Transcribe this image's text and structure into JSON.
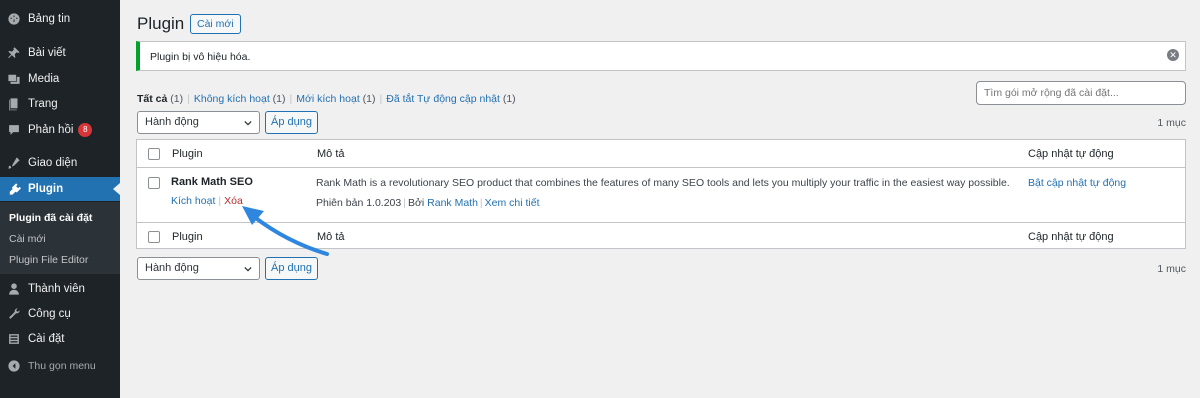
{
  "sidebar": {
    "items": [
      {
        "label": "Bảng tin",
        "icon": "dashboard-icon"
      },
      {
        "label": "Bài viết",
        "icon": "pin-icon"
      },
      {
        "label": "Media",
        "icon": "media-icon"
      },
      {
        "label": "Trang",
        "icon": "page-icon"
      },
      {
        "label": "Phản hồi",
        "icon": "comment-icon",
        "badge": "8"
      },
      {
        "label": "Giao diện",
        "icon": "appearance-icon"
      },
      {
        "label": "Plugin",
        "icon": "plugin-icon"
      },
      {
        "label": "Thành viên",
        "icon": "users-icon"
      },
      {
        "label": "Công cụ",
        "icon": "tools-icon"
      },
      {
        "label": "Cài đặt",
        "icon": "settings-icon"
      },
      {
        "label": "Thu gọn menu",
        "icon": "collapse-icon"
      }
    ],
    "submenu": [
      "Plugin đã cài đặt",
      "Cài mới",
      "Plugin File Editor"
    ]
  },
  "header": {
    "title": "Plugin",
    "add_new": "Cài mới"
  },
  "notice": {
    "text": "Plugin bị vô hiệu hóa."
  },
  "filters": {
    "all": "Tất cả",
    "all_count": "(1)",
    "inactive": "Không kích hoạt",
    "inactive_count": "(1)",
    "recent": "Mới kích hoạt",
    "recent_count": "(1)",
    "autoupdate_off": "Đã tắt Tự động cập nhật",
    "autoupdate_off_count": "(1)"
  },
  "search": {
    "placeholder": "Tìm gói mở rộng đã cài đặt..."
  },
  "bulk": {
    "select_label": "Hành động",
    "apply": "Áp dụng",
    "count": "1 mục"
  },
  "table": {
    "columns": [
      "Plugin",
      "Mô tả",
      "Cập nhật tự động"
    ],
    "rows": [
      {
        "name": "Rank Math SEO",
        "action_activate": "Kích hoạt",
        "action_delete": "Xóa",
        "description": "Rank Math is a revolutionary SEO product that combines the features of many SEO tools and lets you multiply your traffic in the easiest way possible.",
        "version": "Phiên bản 1.0.203",
        "by": "Bởi",
        "author": "Rank Math",
        "details": "Xem chi tiết",
        "auto_update": "Bật cập nhật tự động"
      }
    ]
  },
  "colors": {
    "accent": "#2271b1",
    "sidebar": "#1d2327",
    "notice_success": "#00a32a",
    "delete": "#b32d2e",
    "annotation_arrow": "#2e86de"
  }
}
